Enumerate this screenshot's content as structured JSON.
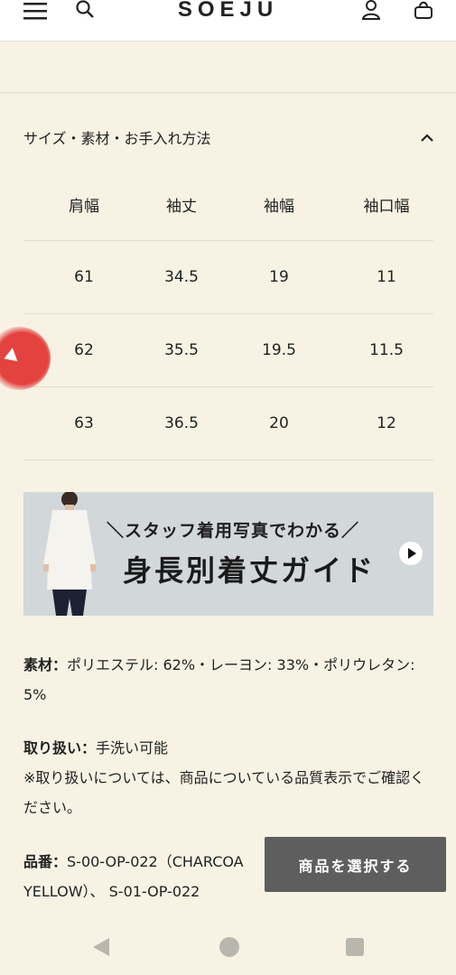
{
  "header": {
    "logo": "SOEJU",
    "icons": [
      "menu-icon",
      "search-icon",
      "user-icon",
      "bag-icon"
    ]
  },
  "accordion": {
    "title": "サイズ・素材・お手入れ方法",
    "toggle_icon": "chevron-up-icon"
  },
  "size_table": {
    "headers": [
      "肩幅",
      "袖丈",
      "袖幅",
      "袖口幅"
    ],
    "rows": [
      [
        "61",
        "34.5",
        "19",
        "11"
      ],
      [
        "62",
        "35.5",
        "19.5",
        "11.5"
      ],
      [
        "63",
        "36.5",
        "20",
        "12"
      ]
    ]
  },
  "banner": {
    "line1": "＼スタッフ着用写真でわかる／",
    "line2": "身長別着丈ガイド",
    "play_icon": "play-icon"
  },
  "material": {
    "label": "素材：",
    "value": "ポリエステル: 62%・レーヨン: 33%・ポリウレタン: 5%"
  },
  "care": {
    "label": "取り扱い：",
    "value": "手洗い可能",
    "note": "※取り扱いについては、商品についている品質表示でご確認ください。"
  },
  "part_number": {
    "label": "品番：",
    "value": "S-00-OP-022（CHARCOAL）、 S-01-OP-022",
    "line1": "S-00-OP-022（CHARCOA",
    "line2": "YELLOW）、 S-01-OP-022"
  },
  "select_button": "商品を選択する",
  "colors": {
    "background": "#f7f2e4",
    "header": "#ffffff",
    "button": "#5e5e5e",
    "banner": "#d2d7da",
    "accent_red": "#e4423f"
  }
}
